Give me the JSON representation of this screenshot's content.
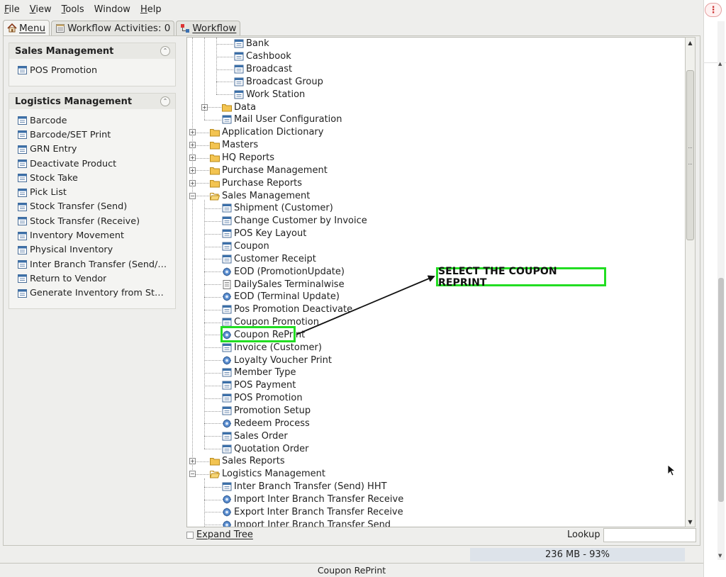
{
  "menubar": {
    "items": [
      {
        "label": "File",
        "mnemonic": "F",
        "rest": "ile"
      },
      {
        "label": "View",
        "mnemonic": "V",
        "rest": "iew"
      },
      {
        "label": "Tools",
        "mnemonic": "T",
        "rest": "ools"
      },
      {
        "label": "Window",
        "mnemonic": "",
        "rest": "Window"
      },
      {
        "label": "Help",
        "mnemonic": "H",
        "rest": "elp"
      }
    ]
  },
  "tabs": {
    "menu": "Menu",
    "workflow_activities": "Workflow Activities: 0",
    "workflow": "Workflow"
  },
  "sales_panel": {
    "title": "Sales Management",
    "items": [
      "POS Promotion"
    ]
  },
  "logistics_panel": {
    "title": "Logistics Management",
    "items": [
      "Barcode",
      "Barcode/SET Print",
      "GRN Entry",
      "Deactivate Product",
      "Stock Take",
      "Pick List",
      "Stock Transfer (Send)",
      "Stock Transfer (Receive)",
      "Inventory Movement",
      "Physical Inventory",
      "Inter Branch Transfer (Send/…",
      "Return to Vendor",
      "Generate Inventory from St…"
    ]
  },
  "tree": {
    "nodes": [
      {
        "label": "Bank",
        "level": 3,
        "icon": "window"
      },
      {
        "label": "Cashbook",
        "level": 3,
        "icon": "window"
      },
      {
        "label": "Broadcast",
        "level": 3,
        "icon": "window"
      },
      {
        "label": "Broadcast Group",
        "level": 3,
        "icon": "window"
      },
      {
        "label": "Work Station",
        "level": 3,
        "icon": "window"
      },
      {
        "label": "Data",
        "level": 2,
        "icon": "folder",
        "expander": "+"
      },
      {
        "label": "Mail User Configuration",
        "level": 2,
        "icon": "window"
      },
      {
        "label": "Application Dictionary",
        "level": 1,
        "icon": "folder",
        "expander": "+"
      },
      {
        "label": "Masters",
        "level": 1,
        "icon": "folder",
        "expander": "+"
      },
      {
        "label": "HQ Reports",
        "level": 1,
        "icon": "folder",
        "expander": "+"
      },
      {
        "label": "Purchase Management",
        "level": 1,
        "icon": "folder",
        "expander": "+"
      },
      {
        "label": "Purchase Reports",
        "level": 1,
        "icon": "folder",
        "expander": "+"
      },
      {
        "label": "Sales Management",
        "level": 1,
        "icon": "folder-open",
        "expander": "-"
      },
      {
        "label": "Shipment (Customer)",
        "level": 2,
        "icon": "window"
      },
      {
        "label": "Change Customer by Invoice",
        "level": 2,
        "icon": "window"
      },
      {
        "label": "POS Key Layout",
        "level": 2,
        "icon": "window"
      },
      {
        "label": "Coupon",
        "level": 2,
        "icon": "window"
      },
      {
        "label": "Customer Receipt",
        "level": 2,
        "icon": "window"
      },
      {
        "label": "EOD (PromotionUpdate)",
        "level": 2,
        "icon": "process"
      },
      {
        "label": "DailySales Terminalwise",
        "level": 2,
        "icon": "report"
      },
      {
        "label": "EOD (Terminal Update)",
        "level": 2,
        "icon": "process"
      },
      {
        "label": "Pos Promotion Deactivate",
        "level": 2,
        "icon": "window"
      },
      {
        "label": "Coupon Promotion",
        "level": 2,
        "icon": "window"
      },
      {
        "label": "Coupon RePrint",
        "level": 2,
        "icon": "process"
      },
      {
        "label": "Invoice (Customer)",
        "level": 2,
        "icon": "window"
      },
      {
        "label": "Loyalty Voucher Print",
        "level": 2,
        "icon": "process"
      },
      {
        "label": "Member Type",
        "level": 2,
        "icon": "window"
      },
      {
        "label": "POS Payment",
        "level": 2,
        "icon": "window"
      },
      {
        "label": "POS Promotion",
        "level": 2,
        "icon": "window"
      },
      {
        "label": "Promotion Setup",
        "level": 2,
        "icon": "window"
      },
      {
        "label": "Redeem Process",
        "level": 2,
        "icon": "process"
      },
      {
        "label": "Sales Order",
        "level": 2,
        "icon": "window"
      },
      {
        "label": "Quotation Order",
        "level": 2,
        "icon": "window"
      },
      {
        "label": "Sales Reports",
        "level": 1,
        "icon": "folder",
        "expander": "+"
      },
      {
        "label": "Logistics Management",
        "level": 1,
        "icon": "folder-open",
        "expander": "-"
      },
      {
        "label": "Inter Branch Transfer (Send) HHT",
        "level": 2,
        "icon": "window"
      },
      {
        "label": "Import Inter Branch Transfer Receive",
        "level": 2,
        "icon": "process"
      },
      {
        "label": "Export Inter Branch Transfer Receive",
        "level": 2,
        "icon": "process"
      },
      {
        "label": "Import Inter Branch Transfer Send",
        "level": 2,
        "icon": "process"
      }
    ]
  },
  "expand_tree_label": "Expand Tree",
  "lookup": {
    "label": "Lookup",
    "value": ""
  },
  "memory_status": "236 MB - 93%",
  "status_text": "Coupon RePrint",
  "annotation": {
    "callout_text": "SELECT THE COUPON REPRINT",
    "color": "#22dd22"
  },
  "colors": {
    "folder": "#e9b93c",
    "window_icon": "#3b6fa8",
    "process_icon": "#4a7fc1",
    "highlight": "#22dd22"
  }
}
